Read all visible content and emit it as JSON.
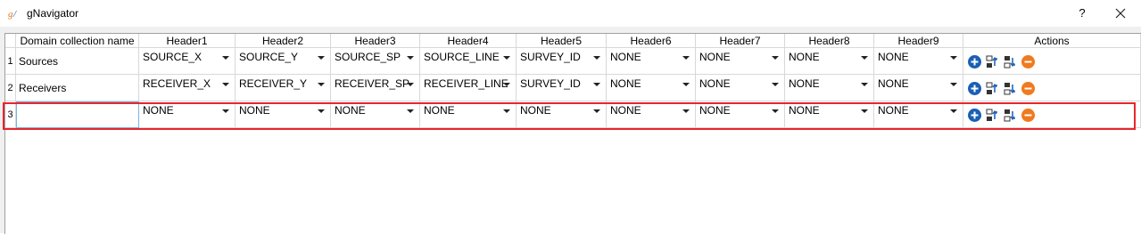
{
  "window": {
    "title": "gNavigator",
    "help_label": "?",
    "close_label": "✕"
  },
  "table": {
    "columns": [
      "Domain collection name",
      "Header1",
      "Header2",
      "Header3",
      "Header4",
      "Header5",
      "Header6",
      "Header7",
      "Header8",
      "Header9",
      "Actions"
    ],
    "rows": [
      {
        "num": "1",
        "name": "Sources",
        "headers": [
          "SOURCE_X",
          "SOURCE_Y",
          "SOURCE_SP",
          "SOURCE_LINE",
          "SURVEY_ID",
          "NONE",
          "NONE",
          "NONE",
          "NONE"
        ]
      },
      {
        "num": "2",
        "name": "Receivers",
        "headers": [
          "RECEIVER_X",
          "RECEIVER_Y",
          "RECEIVER_SP",
          "RECEIVER_LINE",
          "SURVEY_ID",
          "NONE",
          "NONE",
          "NONE",
          "NONE"
        ]
      },
      {
        "num": "3",
        "name": "",
        "headers": [
          "NONE",
          "NONE",
          "NONE",
          "NONE",
          "NONE",
          "NONE",
          "NONE",
          "NONE",
          "NONE"
        ]
      }
    ],
    "action_icons": [
      "add-icon",
      "insert-above-icon",
      "insert-below-icon",
      "remove-icon"
    ]
  },
  "colors": {
    "highlight": "#e8262b",
    "add": "#1a5fb4",
    "remove": "#f07a1e"
  }
}
